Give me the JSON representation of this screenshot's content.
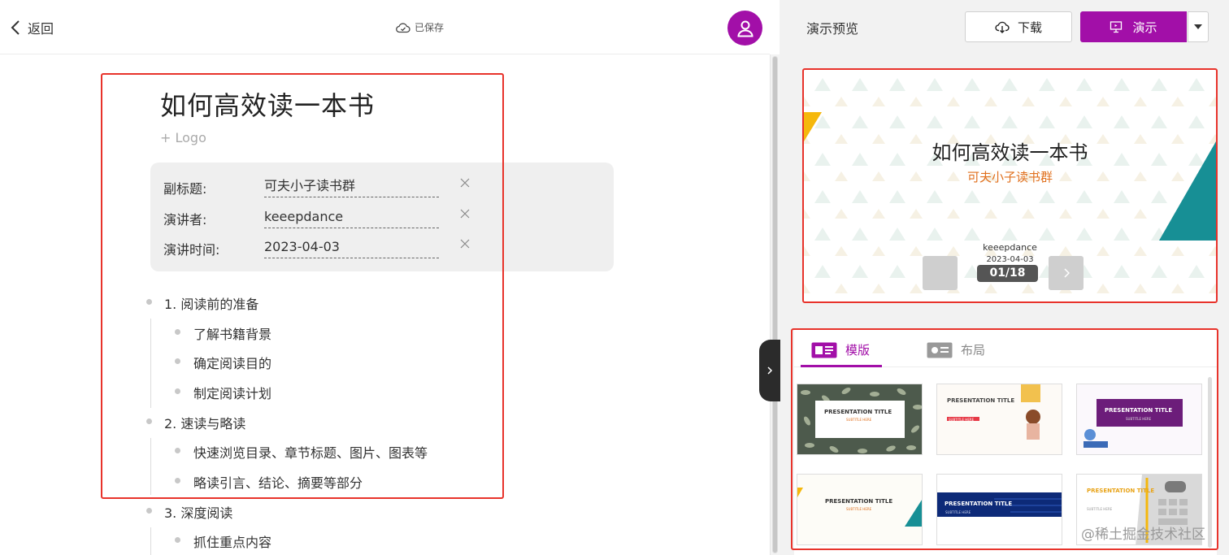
{
  "header": {
    "back_label": "返回",
    "saved_label": "已保存"
  },
  "document": {
    "title": "如何高效读一本书",
    "add_logo": "+ Logo",
    "meta": [
      {
        "label": "副标题:",
        "value": "可夫小子读书群"
      },
      {
        "label": "演讲者:",
        "value": "keeepdance"
      },
      {
        "label": "演讲时间:",
        "value": "2023-04-03"
      }
    ],
    "outline": [
      {
        "text": "1. 阅读前的准备",
        "children": [
          "了解书籍背景",
          "确定阅读目的",
          "制定阅读计划"
        ]
      },
      {
        "text": "2. 速读与略读",
        "children": [
          "快速浏览目录、章节标题、图片、图表等",
          "略读引言、结论、摘要等部分"
        ]
      },
      {
        "text": "3. 深度阅读",
        "children": [
          "抓住重点内容"
        ]
      }
    ]
  },
  "preview": {
    "label": "演示预览",
    "download_label": "下载",
    "present_label": "演示",
    "slide": {
      "title": "如何高效读一本书",
      "subtitle": "可夫小子读书群",
      "speaker": "keeepdance",
      "date": "2023-04-03",
      "counter": "01/18"
    },
    "tabs": {
      "templates": "模版",
      "layout": "布局"
    },
    "templates": [
      {
        "title": "PRESENTATION TITLE",
        "subtitle": "SUBTITLE HERE"
      },
      {
        "title": "PRESENTATION TITLE",
        "subtitle": "SUBTITLE HERE"
      },
      {
        "title": "PRESENTATION TITLE",
        "subtitle": "SUBTITLE HERE"
      },
      {
        "title": "PRESENTATION TITLE",
        "subtitle": "SUBTITLE HERE"
      },
      {
        "title": "PRESENTATION TITLE",
        "subtitle": "SUBTITLE HERE"
      },
      {
        "title": "PRESENTATION TITLE",
        "subtitle": "SUBTITLE HERE"
      }
    ]
  },
  "watermark": "@稀土掘金技术社区",
  "colors": {
    "accent": "#a20fa8",
    "highlight_box": "#e8332b",
    "subtitle_orange": "#e0701e"
  }
}
